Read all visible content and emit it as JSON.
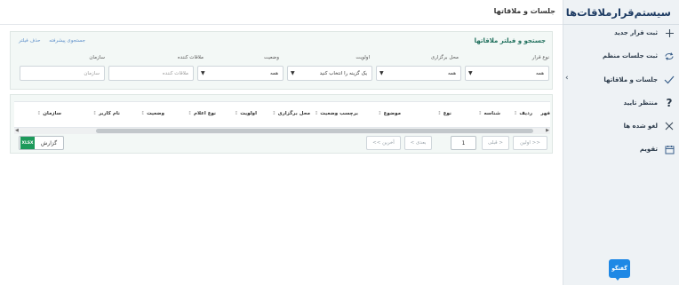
{
  "app": {
    "title": "سیستم‌قرار‌ملاقات‌ها"
  },
  "sidebar": {
    "items": [
      {
        "label": "ثبت قرار جدید",
        "icon": "plus-icon"
      },
      {
        "label": "ثبت جلسات منظم",
        "icon": "recurring-icon"
      },
      {
        "label": "جلسات و ملاقاتها",
        "icon": "check-icon"
      },
      {
        "label": "منتظر تایید",
        "icon": "question-icon"
      },
      {
        "label": "لغو شده ها",
        "icon": "close-icon"
      },
      {
        "label": "تقویم",
        "icon": "calendar-icon"
      }
    ]
  },
  "chat": {
    "label": "گفتگو"
  },
  "page": {
    "title": "جلسات و ملاقاتها"
  },
  "filter": {
    "title": "جستجو و فیلتر ملاقاتها",
    "advanced_search": "جستجوی پیشرفته",
    "clear_filter": "حذف فیلتر",
    "fields": {
      "type": {
        "label": "نوع قرار",
        "value": "همه"
      },
      "location": {
        "label": "محل برگزاری",
        "value": "همه"
      },
      "priority": {
        "label": "اولویت",
        "value": "یک گزینه را انتخاب کنید"
      },
      "status": {
        "label": "وضعیت",
        "value": "همه"
      },
      "visitor": {
        "label": "ملاقات کننده",
        "placeholder": "ملاقات کننده"
      },
      "org": {
        "label": "سازمان",
        "placeholder": "سازمان"
      }
    }
  },
  "table": {
    "columns": [
      "ردیف",
      "شناسه",
      "نوع",
      "موضوع",
      "برچسب وضعیت",
      "محل برگزاری",
      "اولویت",
      "نوع اعلام",
      "وضعیت",
      "نام کاربر",
      "سازمان"
    ],
    "extra_header": "فهر"
  },
  "pagination": {
    "first": "<< اولین",
    "prev": "< قبلی",
    "page": "1",
    "next": "بعدی >",
    "last": "آخرین >>"
  },
  "report": {
    "label": "گزارش",
    "badge": "XLSX"
  }
}
